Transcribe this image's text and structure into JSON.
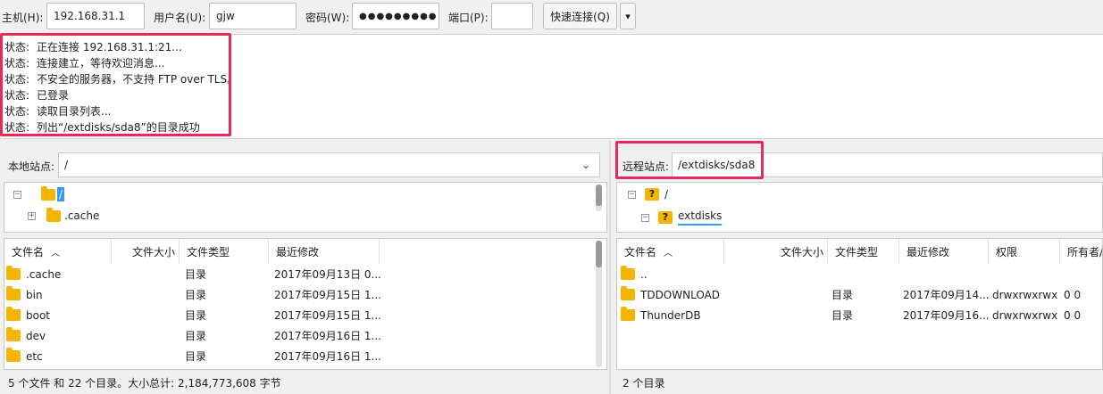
{
  "quickconnect": {
    "host_label": "主机(H):",
    "host_value": "192.168.31.1",
    "user_label": "用户名(U):",
    "user_value": "gjw",
    "pass_label": "密码(W):",
    "pass_value": "●●●●●●●●●",
    "port_label": "端口(P):",
    "port_value": "",
    "connect_label": "快速连接(Q)",
    "dropdown_glyph": "▾"
  },
  "log": [
    {
      "key": "状态:",
      "text": "正在连接 192.168.31.1:21..."
    },
    {
      "key": "状态:",
      "text": "连接建立，等待欢迎消息..."
    },
    {
      "key": "状态:",
      "text": "不安全的服务器，不支持 FTP over TLS。"
    },
    {
      "key": "状态:",
      "text": "已登录"
    },
    {
      "key": "状态:",
      "text": "读取目录列表..."
    },
    {
      "key": "状态:",
      "text": "列出“/extdisks/sda8”的目录成功"
    }
  ],
  "local": {
    "site_label": "本地站点:",
    "site_path": "/",
    "tree": [
      {
        "pm": "−",
        "name": "/"
      },
      {
        "pm": "+",
        "name": ".cache"
      }
    ],
    "columns": {
      "name": "文件名",
      "size": "文件大小",
      "type": "文件类型",
      "modified": "最近修改"
    },
    "rows": [
      {
        "name": ".cache",
        "type": "目录",
        "modified": "2017年09月13日 0..."
      },
      {
        "name": "bin",
        "type": "目录",
        "modified": "2017年09月15日 1..."
      },
      {
        "name": "boot",
        "type": "目录",
        "modified": "2017年09月15日 1..."
      },
      {
        "name": "dev",
        "type": "目录",
        "modified": "2017年09月16日 1..."
      },
      {
        "name": "etc",
        "type": "目录",
        "modified": "2017年09月16日 1..."
      }
    ],
    "status": "5 个文件 和 22 个目录。大小总计: 2,184,773,608 字节"
  },
  "remote": {
    "site_label": "远程站点:",
    "site_path": "/extdisks/sda8",
    "tree": [
      {
        "pm": "−",
        "q": "?",
        "name": "/"
      },
      {
        "pm": "−",
        "q": "?",
        "name": "extdisks"
      }
    ],
    "columns": {
      "name": "文件名",
      "size": "文件大小",
      "type": "文件类型",
      "modified": "最近修改",
      "perm": "权限",
      "owner": "所有者/"
    },
    "rows": [
      {
        "name": "..",
        "type": "",
        "modified": "",
        "perm": "",
        "owner": ""
      },
      {
        "name": "TDDOWNLOAD",
        "type": "目录",
        "modified": "2017年09月14...",
        "perm": "drwxrwxrwx",
        "owner": "0 0"
      },
      {
        "name": "ThunderDB",
        "type": "目录",
        "modified": "2017年09月16...",
        "perm": "drwxrwxrwx",
        "owner": "0 0"
      }
    ],
    "status": "2 个目录"
  },
  "colors": {
    "highlight": "#e8295a",
    "folder": "#f5b400",
    "selection": "#3399ff"
  }
}
